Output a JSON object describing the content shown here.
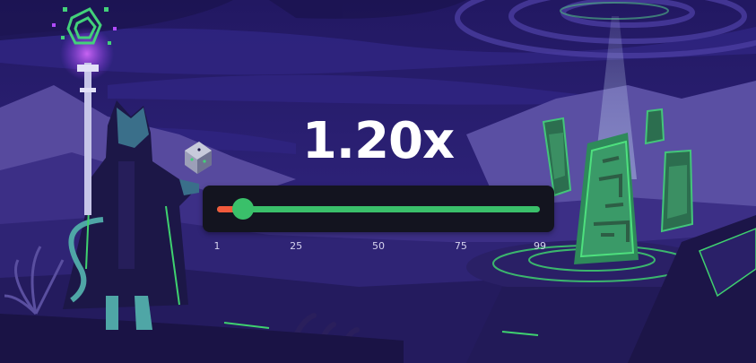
{
  "game": {
    "multiplier": "1.20x",
    "slider": {
      "value": 9,
      "min": 1,
      "max": 99,
      "ticks": [
        "1",
        "25",
        "50",
        "75",
        "99"
      ],
      "colors": {
        "under": "#f25a3c",
        "over": "#3ac06a",
        "panel": "#13141f"
      }
    }
  },
  "scene": {
    "elements": [
      "wizard-cat",
      "magic-staff",
      "floating-dice",
      "glowing-obelisk",
      "rune-stones",
      "vortex-sky"
    ],
    "colors": {
      "sky": "#2a1f6b",
      "mountains": "#564a9c",
      "glow": "#3fd16f",
      "magic": "#b14bff"
    }
  }
}
